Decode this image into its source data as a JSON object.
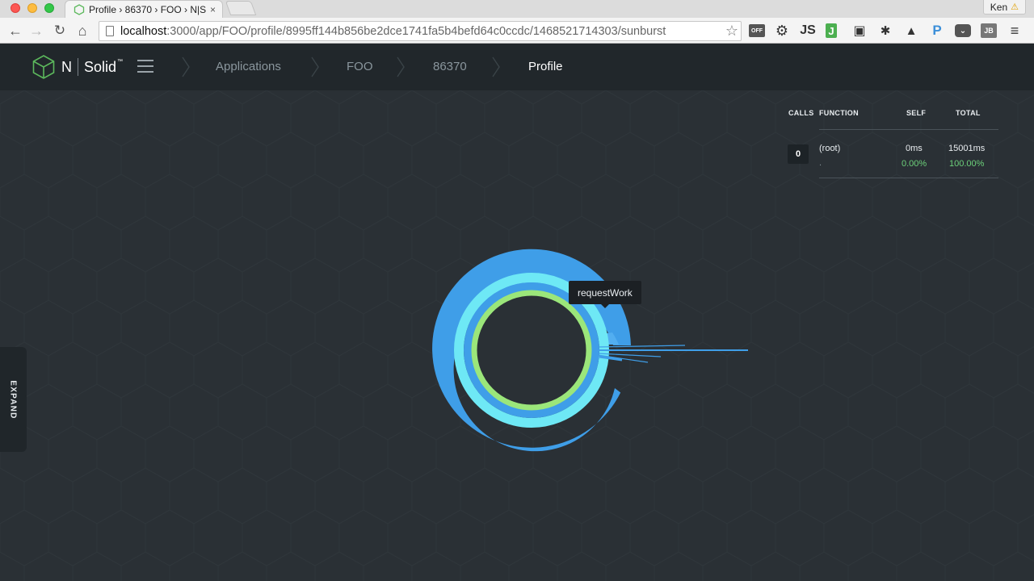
{
  "browser": {
    "tab_title": "Profile › 86370 › FOO › N|S",
    "tab_close": "×",
    "profile_name": "Ken",
    "url_host": "localhost",
    "url_path": ":3000/app/FOO/profile/8995ff144b856be2dce1741fa5b4befd64c0ccdc/1468521714303/sunburst",
    "extensions": [
      "OFF",
      "JS",
      "J",
      "P",
      "JB"
    ]
  },
  "header": {
    "logo_n": "N",
    "logo_solid": "Solid",
    "logo_tm": "™",
    "breadcrumbs": [
      "Applications",
      "FOO",
      "86370",
      "Profile"
    ]
  },
  "profile": {
    "tooltip": "requestWork",
    "expand_label": "EXPAND",
    "table": {
      "headers": {
        "calls": "CALLS",
        "function": "FUNCTION",
        "self": "SELF",
        "total": "TOTAL"
      },
      "rows": [
        {
          "calls": "0",
          "function": "(root)",
          "function_sub": ".",
          "self_time": "0ms",
          "self_pct": "0.00%",
          "total_time": "15001ms",
          "total_pct": "100.00%"
        }
      ]
    }
  },
  "colors": {
    "ring_inner": "#9be67a",
    "ring_middle": "#6ee8f5",
    "ring_outer": "#3f9ee8",
    "pct_text": "#6cd07a",
    "background": "#2a3035",
    "header_bg": "#21272b"
  }
}
